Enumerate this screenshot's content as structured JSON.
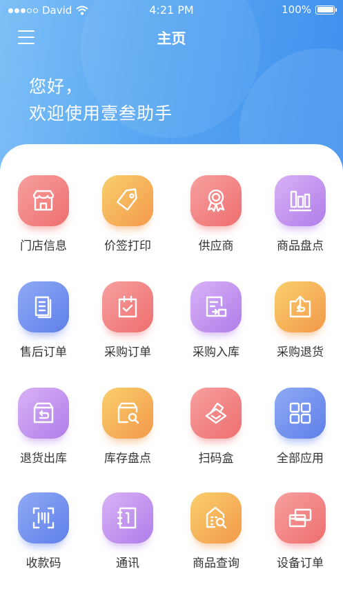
{
  "status_bar": {
    "carrier": "David",
    "time": "4:21 PM",
    "battery": "100%"
  },
  "nav": {
    "title": "主页",
    "menu_icon": "hamburger-menu-icon"
  },
  "greeting": {
    "line1": "您好，",
    "line2": "欢迎使用壹叁助手"
  },
  "colors": {
    "header_gradient": [
      "#7ec0f7",
      "#3f8fee"
    ],
    "red": "#ee6e6e",
    "orange": "#f3994a",
    "purple": "#b07de9",
    "blue": "#5f7fe9"
  },
  "apps": [
    {
      "label": "门店信息",
      "icon": "store-icon",
      "color": "red"
    },
    {
      "label": "价签打印",
      "icon": "price-tag-icon",
      "color": "orange"
    },
    {
      "label": "供应商",
      "icon": "award-ribbon-icon",
      "color": "red"
    },
    {
      "label": "商品盘点",
      "icon": "bar-chart-icon",
      "color": "purple"
    },
    {
      "label": "售后订单",
      "icon": "document-stack-icon",
      "color": "blue"
    },
    {
      "label": "采购订单",
      "icon": "clipboard-check-icon",
      "color": "red"
    },
    {
      "label": "采购入库",
      "icon": "inbound-document-icon",
      "color": "purple"
    },
    {
      "label": "采购退货",
      "icon": "return-box-icon",
      "color": "orange"
    },
    {
      "label": "退货出库",
      "icon": "return-package-icon",
      "color": "purple"
    },
    {
      "label": "库存盘点",
      "icon": "inventory-search-icon",
      "color": "orange"
    },
    {
      "label": "扫码盒",
      "icon": "scanner-box-icon",
      "color": "red"
    },
    {
      "label": "全部应用",
      "icon": "grid-apps-icon",
      "color": "blue"
    },
    {
      "label": "收款码",
      "icon": "scan-code-icon",
      "color": "blue"
    },
    {
      "label": "通讯",
      "icon": "address-book-icon",
      "color": "purple"
    },
    {
      "label": "商品查询",
      "icon": "building-search-icon",
      "color": "orange"
    },
    {
      "label": "设备订单",
      "icon": "devices-icon",
      "color": "red"
    }
  ]
}
